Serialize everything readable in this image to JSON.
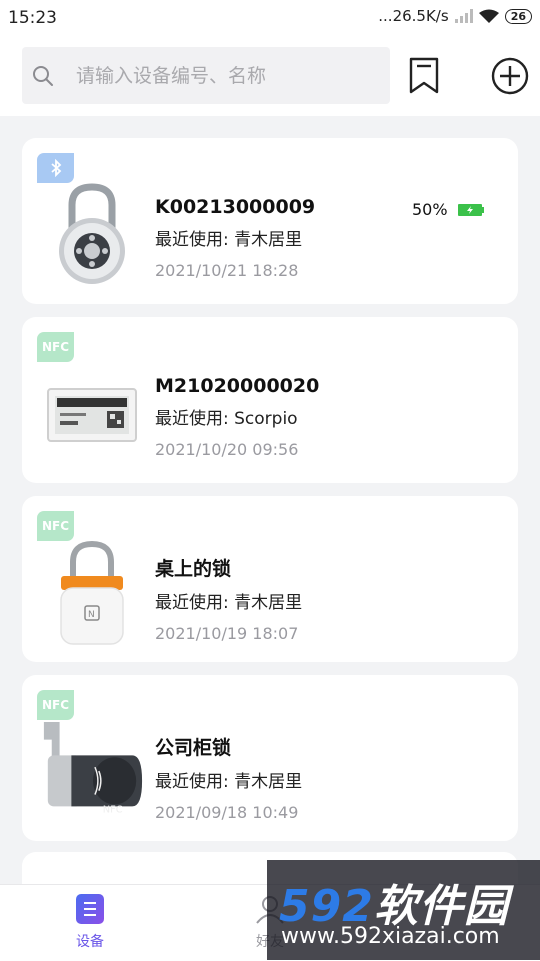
{
  "status_bar": {
    "time": "15:23",
    "network_speed": "...26.5K/s",
    "battery_level": "26"
  },
  "search": {
    "placeholder": "请输入设备编号、名称"
  },
  "devices": [
    {
      "badge": "bluetooth",
      "name": "K00213000009",
      "usage": "最近使用: 青木居里",
      "date": "2021/10/21 18:28",
      "battery": "50%",
      "image": "round-padlock"
    },
    {
      "badge": "NFC",
      "name": "M21020000020",
      "usage": "最近使用: Scorpio",
      "date": "2021/10/20 09:56",
      "image": "electronic-shelf-label"
    },
    {
      "badge": "NFC",
      "name": "桌上的锁",
      "usage": "最近使用: 青木居里",
      "date": "2021/10/19 18:07",
      "image": "nfc-padlock"
    },
    {
      "badge": "NFC",
      "name": "公司柜锁",
      "usage": "最近使用: 青木居里",
      "date": "2021/09/18 10:49",
      "image": "cabinet-lock"
    }
  ],
  "tabs": [
    {
      "label": "设备",
      "active": true
    },
    {
      "label": "好友",
      "active": false
    }
  ],
  "watermark": {
    "logo_num": "592",
    "logo_text": "软件园",
    "url": "www.592xiazai.com"
  },
  "colors": {
    "accent": "#6a56e8",
    "bt_badge": "#a8c9f3",
    "nfc_badge": "#b5e7c9",
    "battery_green": "#3bc14a"
  }
}
